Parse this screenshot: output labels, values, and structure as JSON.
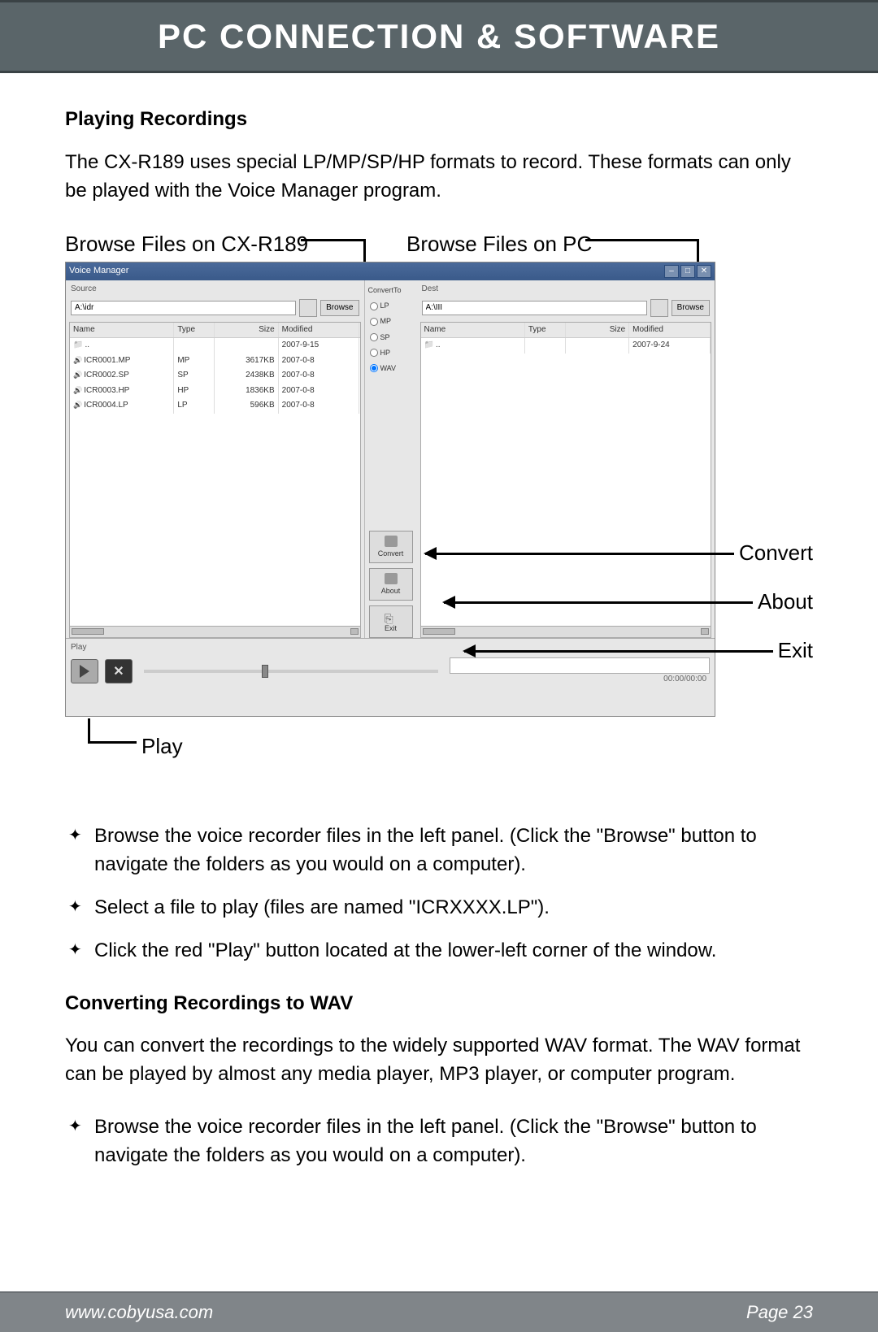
{
  "header": {
    "title": "PC CONNECTION & SOFTWARE"
  },
  "section1": {
    "title": "Playing Recordings",
    "intro": "The CX-R189 uses special LP/MP/SP/HP formats to record. These formats can only be played with the Voice Manager program."
  },
  "figure": {
    "callout_browse_device": "Browse Files on CX-R189",
    "callout_browse_pc": "Browse Files on PC",
    "callout_convert": "Convert",
    "callout_about": "About",
    "callout_exit": "Exit",
    "callout_play": "Play",
    "app": {
      "title": "Voice Manager",
      "win_min": "–",
      "win_max": "□",
      "win_close": "✕",
      "left": {
        "source_label": "Source",
        "path": "A:\\idr",
        "browse_btn": "Browse",
        "columns": {
          "name": "Name",
          "type": "Type",
          "size": "Size",
          "modified": "Modified"
        },
        "rows": [
          {
            "name": "..",
            "type": "",
            "size": "",
            "modified": "2007-9-15",
            "icon": "folder"
          },
          {
            "name": "ICR0001.MP",
            "type": "MP",
            "size": "3617KB",
            "modified": "2007-0-8",
            "icon": "file"
          },
          {
            "name": "ICR0002.SP",
            "type": "SP",
            "size": "2438KB",
            "modified": "2007-0-8",
            "icon": "file"
          },
          {
            "name": "ICR0003.HP",
            "type": "HP",
            "size": "1836KB",
            "modified": "2007-0-8",
            "icon": "file"
          },
          {
            "name": "ICR0004.LP",
            "type": "LP",
            "size": "596KB",
            "modified": "2007-0-8",
            "icon": "file"
          }
        ]
      },
      "right": {
        "source_label": "Dest",
        "path": "A:\\III",
        "browse_btn": "Browse",
        "columns": {
          "name": "Name",
          "type": "Type",
          "size": "Size",
          "modified": "Modified"
        },
        "rows": [
          {
            "name": "..",
            "type": "",
            "size": "",
            "modified": "2007-9-24",
            "icon": "folder"
          }
        ]
      },
      "mid": {
        "group_label": "ConvertTo",
        "options": [
          "LP",
          "MP",
          "SP",
          "HP",
          "WAV"
        ],
        "selected": "WAV",
        "convert_btn": "Convert",
        "about_btn": "About",
        "exit_btn": "Exit"
      },
      "player": {
        "label": "Play",
        "time": "00:00/00:00"
      }
    }
  },
  "bullets1": [
    "Browse the voice recorder files in the left panel. (Click the \"Browse\" button to navigate the folders as you would on a computer).",
    "Select a file to play (files are named \"ICRXXXX.LP\").",
    "Click the red \"Play\" button located at the lower-left corner of the window."
  ],
  "section2": {
    "title": "Converting Recordings to WAV",
    "intro": "You can convert the recordings to the widely supported WAV format. The WAV format can be played by almost any media player, MP3 player, or computer program."
  },
  "bullets2": [
    "Browse the voice recorder files in the left panel. (Click the \"Browse\" button to navigate the folders as you would on a computer)."
  ],
  "footer": {
    "url": "www.cobyusa.com",
    "page": "Page 23"
  }
}
